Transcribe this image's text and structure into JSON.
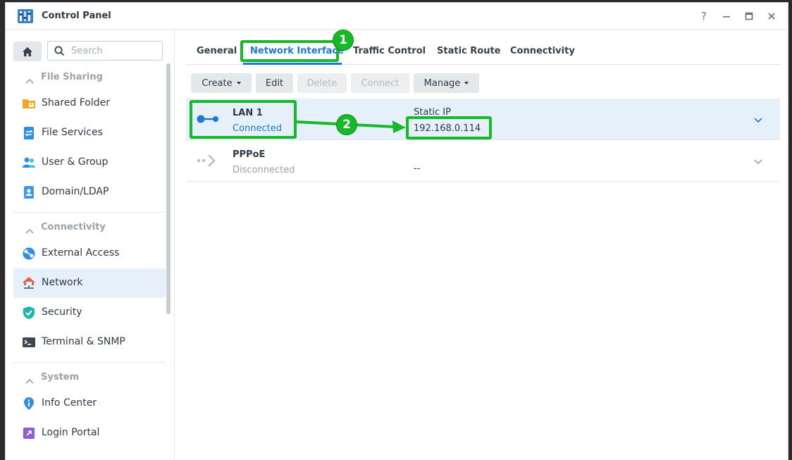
{
  "window": {
    "title": "Control Panel"
  },
  "window_controls": {
    "help": "?"
  },
  "search": {
    "placeholder": "Search"
  },
  "sidebar": {
    "sections": [
      {
        "label": "File Sharing",
        "items": [
          {
            "label": "Shared Folder",
            "icon": "shared-folder-icon"
          },
          {
            "label": "File Services",
            "icon": "file-services-icon"
          },
          {
            "label": "User & Group",
            "icon": "user-group-icon"
          },
          {
            "label": "Domain/LDAP",
            "icon": "domain-ldap-icon"
          }
        ]
      },
      {
        "label": "Connectivity",
        "items": [
          {
            "label": "External Access",
            "icon": "external-access-icon"
          },
          {
            "label": "Network",
            "icon": "network-icon",
            "active": true
          },
          {
            "label": "Security",
            "icon": "shield-check-icon"
          },
          {
            "label": "Terminal & SNMP",
            "icon": "terminal-icon"
          }
        ]
      },
      {
        "label": "System",
        "items": [
          {
            "label": "Info Center",
            "icon": "info-icon"
          },
          {
            "label": "Login Portal",
            "icon": "login-portal-icon"
          }
        ]
      }
    ]
  },
  "tabs": [
    {
      "label": "General"
    },
    {
      "label": "Network Interface",
      "active": true
    },
    {
      "label": "Traffic Control"
    },
    {
      "label": "Static Route"
    },
    {
      "label": "Connectivity"
    }
  ],
  "toolbar": {
    "create": "Create",
    "edit": "Edit",
    "delete": "Delete",
    "connect": "Connect",
    "manage": "Manage"
  },
  "interfaces": [
    {
      "name": "LAN 1",
      "status": "Connected",
      "type": "Static IP",
      "ip": "192.168.0.114"
    },
    {
      "name": "PPPoE",
      "status": "Disconnected",
      "type": "",
      "ip": "--"
    }
  ],
  "annotations": {
    "step1": "1",
    "step2": "2"
  },
  "colors": {
    "accent": "#1d78d6",
    "highlight": "#16b928",
    "selected_bg": "#e6f0fb"
  }
}
